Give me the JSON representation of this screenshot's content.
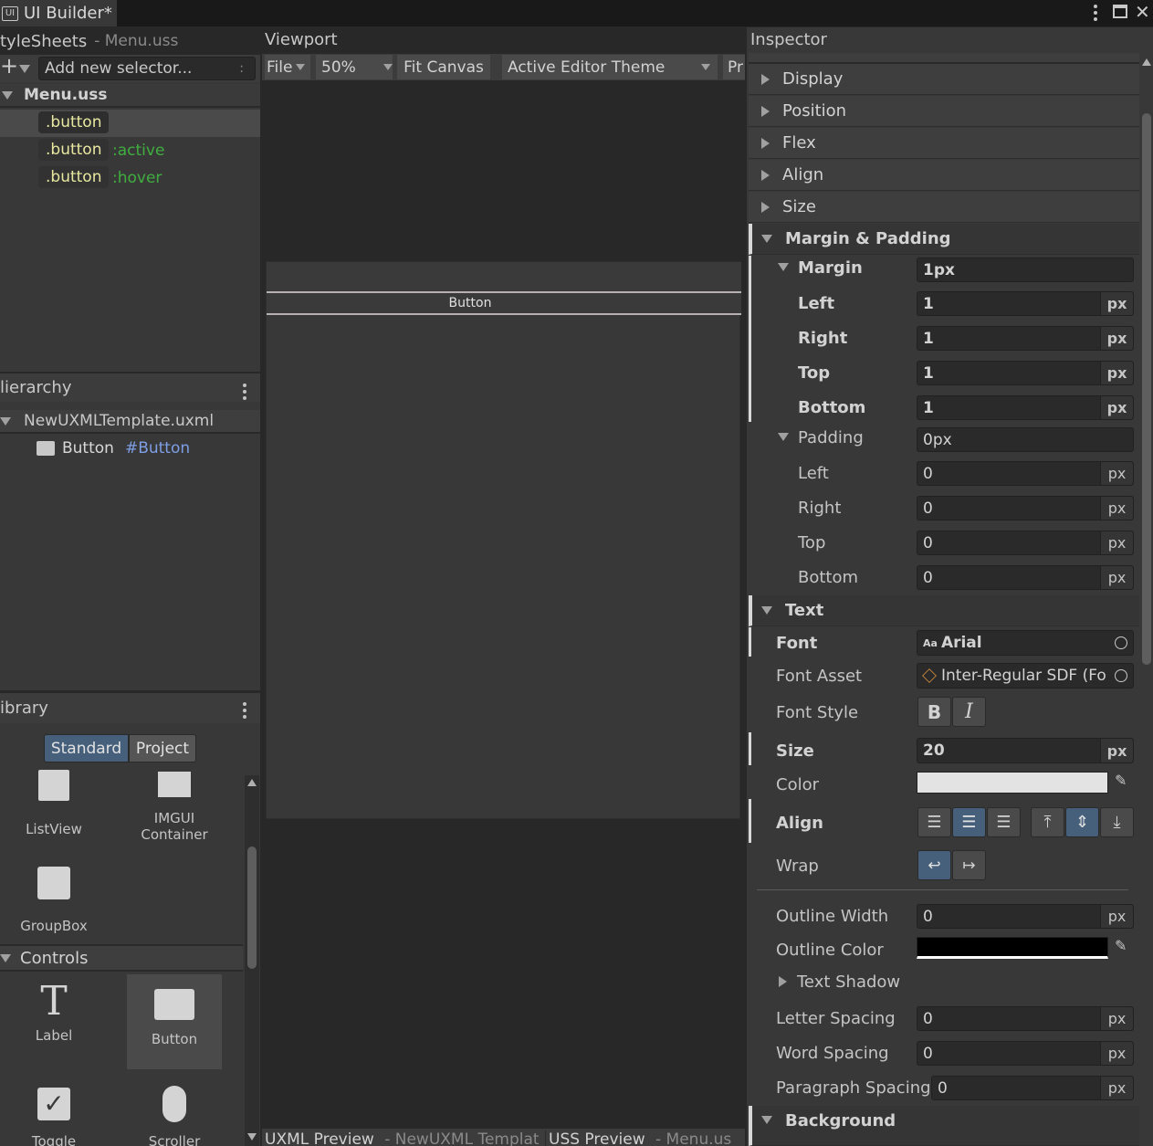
{
  "window": {
    "title": "UI Builder*",
    "controls": [
      "more-icon",
      "maximize-icon",
      "close-icon"
    ]
  },
  "stylesheets": {
    "header_title": "tyleSheets",
    "header_sub": "- Menu.uss",
    "add_selector_placeholder": "Add new selector...",
    "file_name": "Menu.uss",
    "selectors": [
      {
        "name": ".button",
        "pseudo": ""
      },
      {
        "name": ".button",
        "pseudo": ":active"
      },
      {
        "name": ".button",
        "pseudo": ":hover"
      }
    ]
  },
  "hierarchy": {
    "header_title": "lierarchy",
    "root": "NewUXMLTemplate.uxml",
    "child_type": "Button",
    "child_name": "#Button"
  },
  "library": {
    "header_title": "ibrary",
    "tabs": [
      "Standard",
      "Project"
    ],
    "items_top": [
      {
        "label": "ListView",
        "icon": "listview-icon"
      },
      {
        "label": "IMGUI\nContainer",
        "icon": "imgui-icon"
      },
      {
        "label": "GroupBox",
        "icon": "groupbox-icon"
      }
    ],
    "controls_section": "Controls",
    "controls": [
      {
        "label": "Label",
        "icon": "label-icon"
      },
      {
        "label": "Button",
        "icon": "button-icon"
      },
      {
        "label": "Toggle",
        "icon": "toggle-icon"
      },
      {
        "label": "Scroller",
        "icon": "scroller-icon"
      }
    ]
  },
  "viewport": {
    "header_title": "Viewport",
    "file_menu": "File",
    "zoom": "50%",
    "fit_canvas": "Fit Canvas",
    "theme": "Active Editor Theme",
    "preview_cut": "Pr",
    "canvas_button_label": "Button",
    "uxml_preview": "UXML Preview",
    "uxml_preview_sub": "- NewUXML Templat",
    "uss_preview": "USS Preview",
    "uss_preview_sub": "- Menu.us"
  },
  "inspector": {
    "header_title": "Inspector",
    "collapsed_sections": [
      "Display",
      "Position",
      "Flex",
      "Align",
      "Size"
    ],
    "margin_padding": "Margin & Padding",
    "margin": {
      "label": "Margin",
      "value": "1px",
      "rows": [
        {
          "label": "Left",
          "value": "1",
          "unit": "px"
        },
        {
          "label": "Right",
          "value": "1",
          "unit": "px"
        },
        {
          "label": "Top",
          "value": "1",
          "unit": "px"
        },
        {
          "label": "Bottom",
          "value": "1",
          "unit": "px"
        }
      ]
    },
    "padding": {
      "label": "Padding",
      "value": "0px",
      "rows": [
        {
          "label": "Left",
          "value": "0",
          "unit": "px"
        },
        {
          "label": "Right",
          "value": "0",
          "unit": "px"
        },
        {
          "label": "Top",
          "value": "0",
          "unit": "px"
        },
        {
          "label": "Bottom",
          "value": "0",
          "unit": "px"
        }
      ]
    },
    "text_section": "Text",
    "font_label": "Font",
    "font_prefix": "Aa",
    "font_value": "Arial",
    "font_asset_label": "Font Asset",
    "font_asset_value": "Inter-Regular SDF (Fo",
    "font_style_label": "Font Style",
    "font_style_bold": "B",
    "font_style_italic": "I",
    "size_label": "Size",
    "size_value": "20",
    "size_unit": "px",
    "color_label": "Color",
    "color_value": "#e3e3e3",
    "align_label": "Align",
    "wrap_label": "Wrap",
    "outline_width_label": "Outline Width",
    "outline_width_value": "0",
    "outline_color_label": "Outline Color",
    "outline_color_value": "#000000",
    "text_shadow_label": "Text Shadow",
    "letter_spacing_label": "Letter Spacing",
    "letter_spacing_value": "0",
    "word_spacing_label": "Word Spacing",
    "word_spacing_value": "0",
    "paragraph_spacing_label": "Paragraph Spacing",
    "paragraph_spacing_value": "0",
    "unit": "px",
    "background_section": "Background"
  },
  "colors": {
    "accent_blue": "#46607c",
    "selector_yellow": "#e8e8a0",
    "pseudo_green": "#3fae3f",
    "name_blue": "#7e9fe6"
  }
}
